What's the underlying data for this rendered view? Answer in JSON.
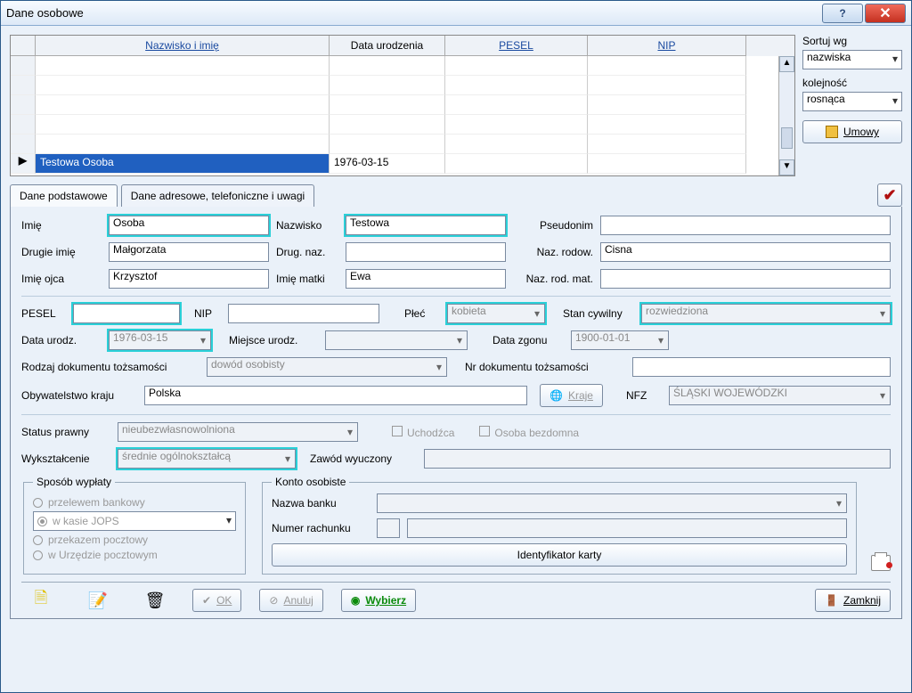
{
  "window": {
    "title": "Dane osobowe"
  },
  "sort": {
    "label1": "Sortuj wg",
    "value1": "nazwiska",
    "label2": "kolejność",
    "value2": "rosnąca",
    "umowy": "Umowy"
  },
  "grid": {
    "headers": {
      "sel": "",
      "name": "Nazwisko i imię",
      "dob": "Data urodzenia",
      "pesel": "PESEL",
      "nip": "NIP"
    },
    "row": {
      "name": "Testowa Osoba",
      "dob": "1976-03-15",
      "pesel": "",
      "nip": ""
    }
  },
  "tabs": {
    "t1": "Dane podstawowe",
    "t2": "Dane adresowe, telefoniczne i uwagi"
  },
  "fields": {
    "imie_l": "Imię",
    "imie_v": "Osoba",
    "nazwisko_l": "Nazwisko",
    "nazwisko_v": "Testowa",
    "pseudonim_l": "Pseudonim",
    "pseudonim_v": "",
    "drugie_l": "Drugie imię",
    "drugie_v": "Małgorzata",
    "drugnaz_l": "Drug. naz.",
    "drugnaz_v": "",
    "nazrodow_l": "Naz. rodow.",
    "nazrodow_v": "Cisna",
    "ojciec_l": "Imię ojca",
    "ojciec_v": "Krzysztof",
    "matka_l": "Imię matki",
    "matka_v": "Ewa",
    "nazrodmat_l": "Naz. rod. mat.",
    "nazrodmat_v": "",
    "pesel_l": "PESEL",
    "pesel_v": "",
    "nip_l": "NIP",
    "nip_v": "",
    "plec_l": "Płeć",
    "plec_v": "kobieta",
    "stan_l": "Stan cywilny",
    "stan_v": "rozwiedziona",
    "dataur_l": "Data urodz.",
    "dataur_v": "1976-03-15",
    "miejur_l": "Miejsce urodz.",
    "miejur_v": "",
    "datazg_l": "Data zgonu",
    "datazg_v": "1900-01-01",
    "rodzdok_l": "Rodzaj dokumentu tożsamości",
    "rodzdok_v": "dowód osobisty",
    "nrdok_l": "Nr dokumentu tożsamości",
    "nrdok_v": "",
    "obyw_l": "Obywatelstwo kraju",
    "obyw_v": "Polska",
    "kraje_btn": "Kraje",
    "nfz_l": "NFZ",
    "nfz_v": "ŚLĄSKI WOJEWÓDZKI",
    "status_l": "Status prawny",
    "status_v": "nieubezwłasnowolniona",
    "uchodzca_l": "Uchodźca",
    "bezdomna_l": "Osoba bezdomna",
    "wyksz_l": "Wykształcenie",
    "wyksz_v": "średnie ogólnokształcą",
    "zawod_l": "Zawód wyuczony",
    "zawod_v": "",
    "sposob_legend": "Sposób wypłaty",
    "r1": "przelewem bankowy",
    "r2": "w kasie JOPS",
    "r3": "przekazem pocztowy",
    "r4": "w Urzędzie pocztowym",
    "konto_legend": "Konto osobiste",
    "bank_l": "Nazwa banku",
    "rach_l": "Numer rachunku",
    "ident_btn": "Identyfikator karty"
  },
  "buttons": {
    "ok": "OK",
    "anuluj": "Anuluj",
    "wybierz": "Wybierz",
    "zamknij": "Zamknij"
  }
}
